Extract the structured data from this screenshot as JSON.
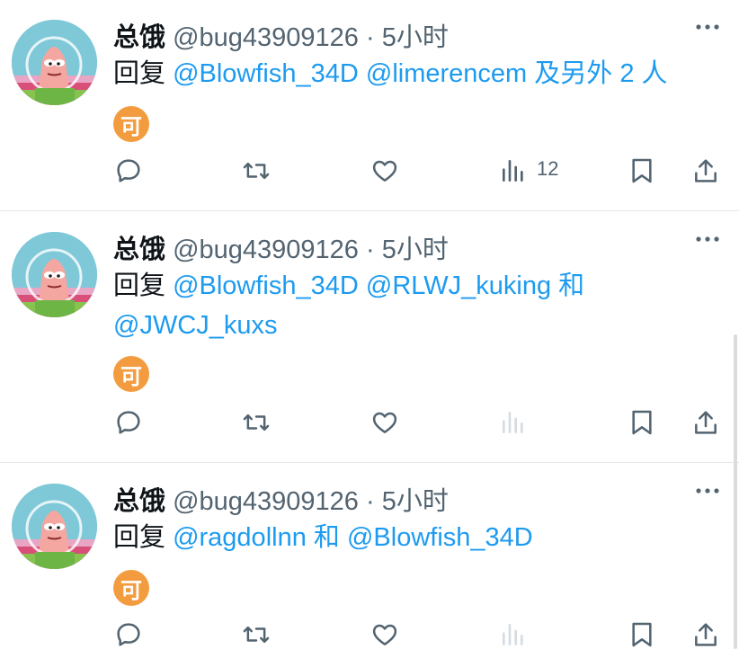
{
  "tweets": [
    {
      "name": "总饿",
      "handle": "@bug43909126",
      "dot": "·",
      "time": "5小时",
      "reply_prefix": "回复",
      "reply_line1": [
        {
          "text": "@Blowfish_34D",
          "type": "mention"
        },
        {
          "text": " "
        },
        {
          "text": "@limerencem",
          "type": "mention"
        },
        {
          "text": " "
        },
        {
          "text": "及另外 2 人",
          "type": "link"
        }
      ],
      "reply_line2": [],
      "emoji": "可",
      "views": "12",
      "views_active": true
    },
    {
      "name": "总饿",
      "handle": "@bug43909126",
      "dot": "·",
      "time": "5小时",
      "reply_prefix": "回复",
      "reply_line1": [
        {
          "text": "@Blowfish_34D",
          "type": "mention"
        },
        {
          "text": " "
        },
        {
          "text": "@RLWJ_kuking",
          "type": "mention"
        },
        {
          "text": " "
        },
        {
          "text": "和",
          "type": "link"
        }
      ],
      "reply_line2": [
        {
          "text": "@JWCJ_kuxs",
          "type": "mention"
        }
      ],
      "emoji": "可",
      "views": "",
      "views_active": false
    },
    {
      "name": "总饿",
      "handle": "@bug43909126",
      "dot": "·",
      "time": "5小时",
      "reply_prefix": "回复",
      "reply_line1": [
        {
          "text": "@ragdollnn",
          "type": "mention"
        },
        {
          "text": " 和 ",
          "type": "link"
        },
        {
          "text": "@Blowfish_34D",
          "type": "mention"
        }
      ],
      "reply_line2": [],
      "emoji": "可",
      "views": "",
      "views_active": false
    }
  ],
  "colors": {
    "accent": "#1d9bf0",
    "muted": "#536471",
    "emoji_bg": "#f39c3f",
    "views_disabled": "#d6dde2"
  },
  "icons": [
    "more-dots-icon",
    "reply-icon",
    "retweet-icon",
    "like-icon",
    "views-icon",
    "bookmark-icon",
    "share-icon"
  ]
}
